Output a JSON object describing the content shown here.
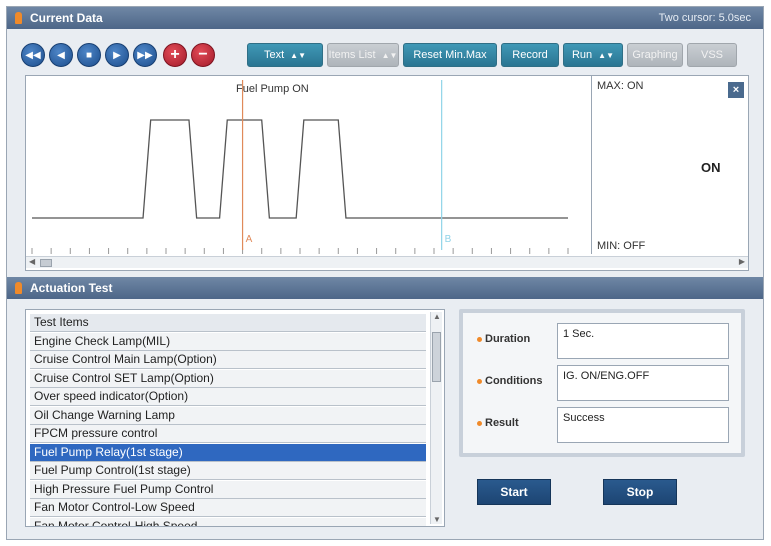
{
  "current_data": {
    "title": "Current Data",
    "cursor_info": "Two cursor: 5.0sec"
  },
  "toolbar": {
    "media": [
      "rewind-icon",
      "prev-icon",
      "stop-icon",
      "play-icon",
      "fast-forward-icon"
    ],
    "add_label": "+",
    "remove_label": "−",
    "text_label": "Text",
    "items_list_label": "Items List",
    "reset_label": "Reset Min.Max",
    "record_label": "Record",
    "run_label": "Run",
    "graphing_label": "Graphing",
    "vss_label": "VSS"
  },
  "graph": {
    "signal_label": "Fuel Pump ON",
    "max_label": "MAX: ON",
    "min_label": "MIN: OFF",
    "current_value": "ON",
    "cursor_a_label": "A",
    "cursor_b_label": "B",
    "close_label": "×",
    "waveform": [
      {
        "t": 0,
        "v": 0
      },
      {
        "t": 1.45,
        "v": 0
      },
      {
        "t": 1.55,
        "v": 1
      },
      {
        "t": 2.05,
        "v": 1
      },
      {
        "t": 2.15,
        "v": 0
      },
      {
        "t": 2.45,
        "v": 0
      },
      {
        "t": 2.55,
        "v": 1
      },
      {
        "t": 3.0,
        "v": 1
      },
      {
        "t": 3.1,
        "v": 0
      },
      {
        "t": 3.45,
        "v": 0
      },
      {
        "t": 3.55,
        "v": 1
      },
      {
        "t": 4.0,
        "v": 1
      },
      {
        "t": 4.1,
        "v": 0
      },
      {
        "t": 7.0,
        "v": 0
      }
    ],
    "cursor_a_t": 2.75,
    "cursor_b_t": 5.35,
    "t_max": 7.0,
    "colors": {
      "line": "#555555",
      "cursor_a": "#e08a5a",
      "cursor_b": "#8fd3e8"
    }
  },
  "actuation": {
    "title": "Actuation Test",
    "items_header": "Test Items",
    "items": [
      "Engine Check Lamp(MIL)",
      "Cruise Control Main Lamp(Option)",
      "Cruise Control SET Lamp(Option)",
      "Over speed indicator(Option)",
      "Oil Change Warning Lamp",
      "FPCM pressure control",
      "Fuel Pump Relay(1st stage)",
      "Fuel Pump Control(1st stage)",
      "High Pressure Fuel Pump Control",
      "Fan Motor Control-Low Speed",
      "Fan Motor Control-High Speed"
    ],
    "selected_index": 6,
    "duration_label": "Duration",
    "duration_value": "1 Sec.",
    "conditions_label": "Conditions",
    "conditions_value": "IG. ON/ENG.OFF",
    "result_label": "Result",
    "result_value": "Success",
    "start_label": "Start",
    "stop_label": "Stop"
  }
}
